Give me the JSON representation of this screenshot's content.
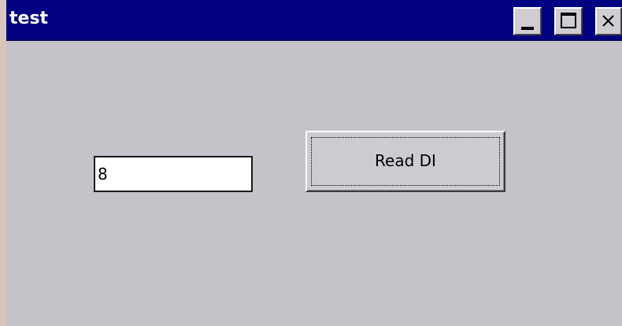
{
  "window": {
    "title": "test"
  },
  "controls": {
    "minimize_icon": "minimize-icon",
    "maximize_icon": "maximize-icon",
    "close_icon": "close-icon"
  },
  "main": {
    "textbox_value": "8",
    "read_button_label": "Read DI"
  },
  "colors": {
    "titlebar": "#000080",
    "client_background": "#c5c3c9",
    "button_face": "#cdcbd1"
  }
}
